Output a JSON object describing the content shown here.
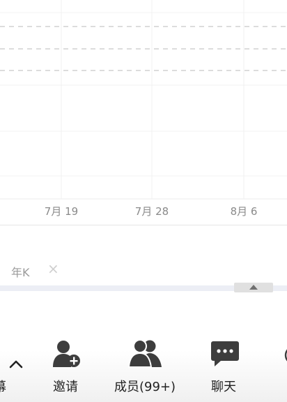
{
  "chart_data": {
    "type": "line",
    "x_ticks": [
      "7月 19",
      "7月 28",
      "8月 6"
    ],
    "series": [],
    "grid": true
  },
  "period_filter": {
    "label": "年K",
    "close_glyph": "×"
  },
  "toolbar": {
    "collapse_glyph": "^",
    "cut_label": "幕",
    "items": [
      {
        "label": "邀请",
        "icon": "add-person-icon"
      },
      {
        "label": "成员(99+)",
        "icon": "members-icon"
      },
      {
        "label": "聊天",
        "icon": "chat-icon"
      }
    ]
  },
  "colors": {
    "grid": "#eeeeee",
    "dashed": "#c8c8c8",
    "icon": "#3d3d3d",
    "label": "#222222"
  }
}
